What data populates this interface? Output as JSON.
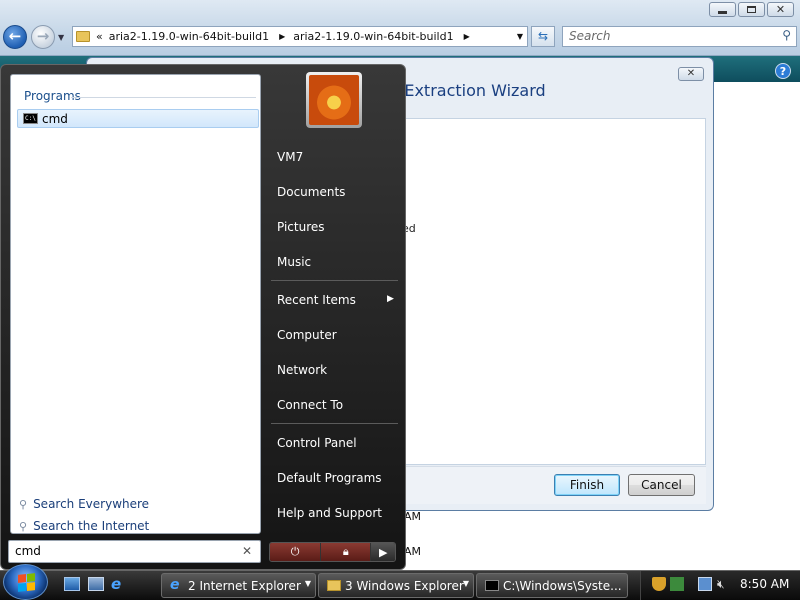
{
  "explorer": {
    "address": {
      "overflow": "«",
      "crumbs": [
        "aria2-1.19.0-win-64bit-build1",
        "aria2-1.19.0-win-64bit-build1"
      ]
    },
    "search_placeholder": "Search",
    "help": "?"
  },
  "wizard": {
    "title_partial": "ped) Folders Extraction Wizard",
    "body_partial": "ed",
    "finish_label": "Finish",
    "cancel_label": "Cancel",
    "bg_time_1": "AM",
    "bg_time_2": "AM"
  },
  "startmenu": {
    "programs_header": "Programs",
    "program_items": [
      {
        "label": "cmd",
        "icon": "cmd-icon"
      }
    ],
    "search_everywhere": "Search Everywhere",
    "search_internet": "Search the Internet",
    "search_value": "cmd",
    "user": "VM7",
    "right_items": {
      "documents": "Documents",
      "pictures": "Pictures",
      "music": "Music",
      "recent_items": "Recent Items",
      "computer": "Computer",
      "network": "Network",
      "connect_to": "Connect To",
      "control_panel": "Control Panel",
      "default_programs": "Default Programs",
      "help_support": "Help and Support"
    }
  },
  "taskbar": {
    "buttons": [
      {
        "label": "2 Internet Explorer"
      },
      {
        "label": "3 Windows Explorer"
      },
      {
        "label": "C:\\Windows\\Syste..."
      }
    ],
    "clock": "8:50 AM"
  }
}
